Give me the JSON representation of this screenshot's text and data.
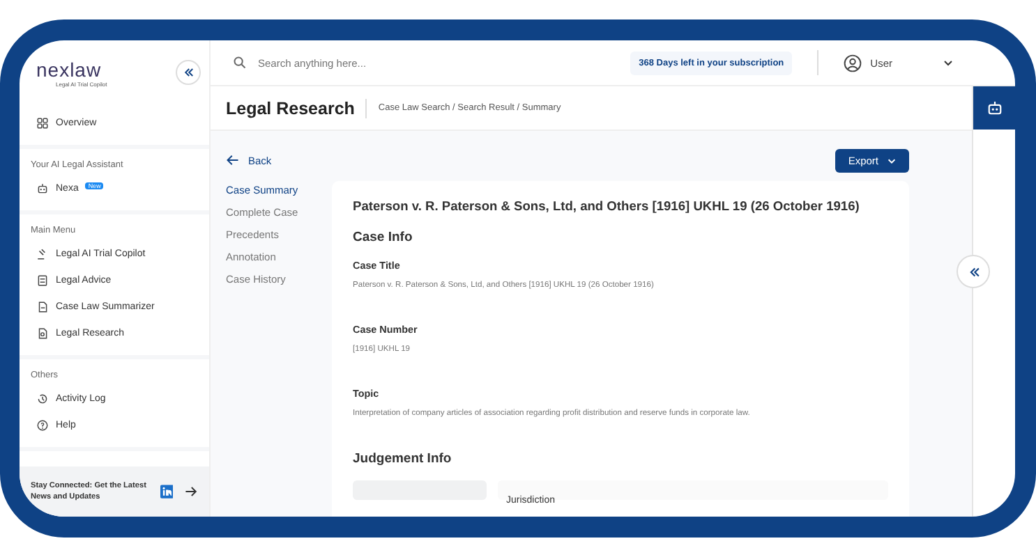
{
  "logo": {
    "name": "nexlaw",
    "tagline": "Legal AI Trial Copilot"
  },
  "sidebar": {
    "groups": [
      {
        "items": [
          {
            "label": "Overview"
          }
        ]
      },
      {
        "heading": "Your AI Legal Assistant",
        "items": [
          {
            "label": "Nexa",
            "badge": "New"
          }
        ]
      },
      {
        "heading": "Main Menu",
        "items": [
          {
            "label": "Legal AI Trial Copilot"
          },
          {
            "label": "Legal Advice"
          },
          {
            "label": "Case Law Summarizer"
          },
          {
            "label": "Legal Research"
          }
        ]
      },
      {
        "heading": "Others",
        "items": [
          {
            "label": "Activity Log"
          },
          {
            "label": "Help"
          }
        ]
      }
    ],
    "footer": "Stay Connected: Get the Latest News and Updates"
  },
  "topbar": {
    "search": {
      "placeholder": "Search anything here..."
    },
    "subscription": "368 Days left in your subscription",
    "user": "User"
  },
  "header": {
    "title": "Legal Research",
    "breadcrumb": "Case Law Search / Search Result / Summary"
  },
  "back": "Back",
  "export": "Export",
  "sections": [
    {
      "label": "Case Summary",
      "selected": true
    },
    {
      "label": "Complete Case",
      "selected": false
    },
    {
      "label": "Precedents",
      "selected": false
    },
    {
      "label": "Annotation",
      "selected": false
    },
    {
      "label": "Case History",
      "selected": false
    }
  ],
  "case": {
    "title": "Paterson v. R. Paterson & Sons, Ltd, and Others [1916] UKHL 19 (26 October 1916)",
    "info_heading": "Case Info",
    "fields": [
      {
        "label": "Case Title",
        "value": "Paterson v. R. Paterson & Sons, Ltd, and Others [1916] UKHL 19 (26 October 1916)"
      },
      {
        "label": "Case Number",
        "value": "[1916] UKHL 19"
      },
      {
        "label": "Topic",
        "value": "Interpretation of company articles of association regarding profit distribution and reserve funds in corporate law."
      }
    ],
    "judgement_heading": "Judgement Info",
    "jurisdiction_label": "Jurisdiction"
  }
}
